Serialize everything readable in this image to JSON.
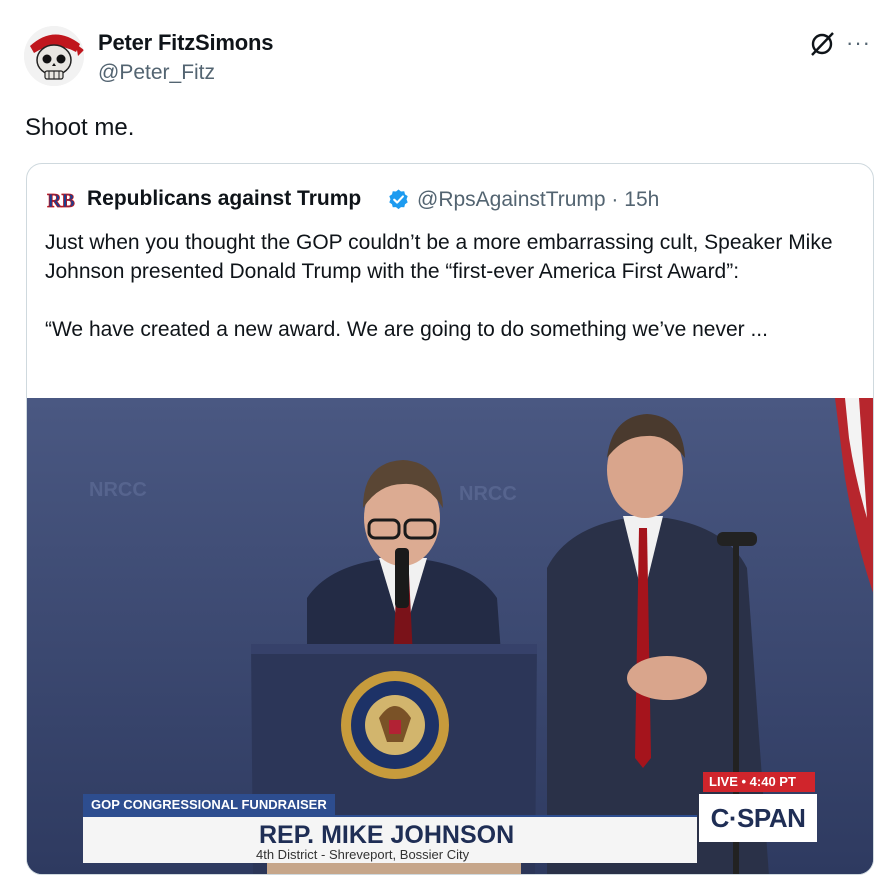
{
  "author": {
    "name": "Peter FitzSimons",
    "handle": "@Peter_Fitz",
    "avatar_icon": "pirate-skull-icon"
  },
  "tweet": {
    "text": "Shoot me."
  },
  "header_icons": [
    "grok-icon",
    "more-icon"
  ],
  "more_label": "···",
  "quote": {
    "name": "Republicans against Trump",
    "handle_time": "@RpsAgainstTrump · 15h",
    "avatar_label": "RB",
    "paragraphs": [
      "Just when you thought the GOP couldn’t be a more embarrassing cult, Speaker Mike Johnson presented Donald Trump with the “first-ever America First Award”:",
      "“We have created a new award. We are going to do something we’ve never ..."
    ]
  },
  "video": {
    "lower_third_tag": "GOP CONGRESSIONAL FUNDRAISER",
    "speaker_name": "REP. MIKE JOHNSON",
    "speaker_sub": "4th District - Shreveport, Bossier City",
    "live_label": "LIVE • 4:40 PT",
    "network": "C·SPAN"
  },
  "colors": {
    "verified": "#1d9bf0",
    "handle_gray": "#536471",
    "border": "#cfd9de",
    "cspan_blue": "#1f2e55",
    "live_red": "#d0252c"
  }
}
